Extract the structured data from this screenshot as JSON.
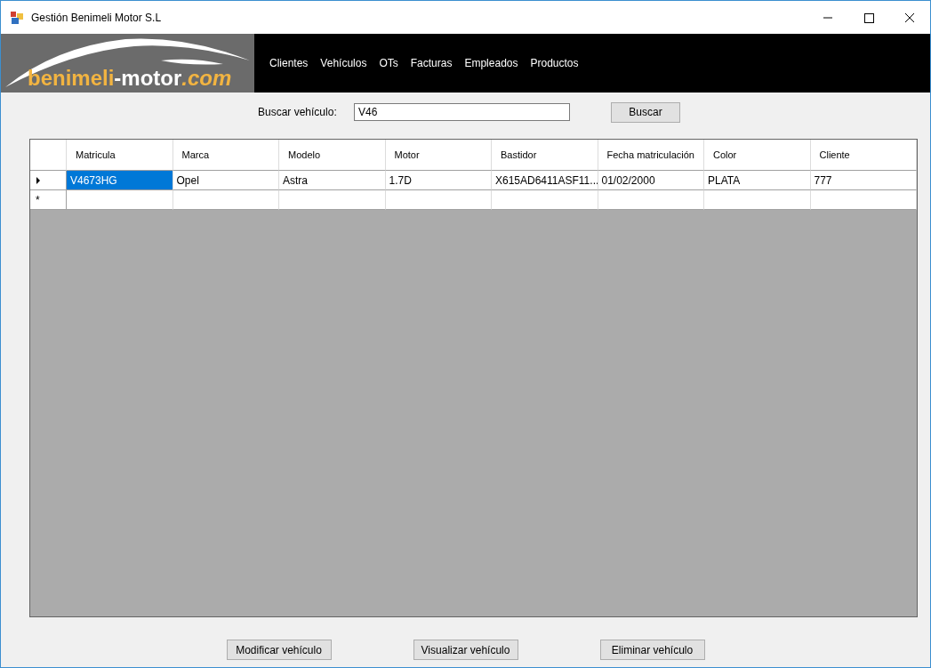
{
  "window": {
    "title": "Gestión Benimeli Motor S.L"
  },
  "logo": [
    "benimeli",
    "-motor",
    ".com"
  ],
  "menu": [
    {
      "label": "Clientes"
    },
    {
      "label": "Vehículos"
    },
    {
      "label": "OTs"
    },
    {
      "label": "Facturas"
    },
    {
      "label": "Empleados"
    },
    {
      "label": "Productos"
    }
  ],
  "search": {
    "label": "Buscar vehículo:",
    "value": "V46",
    "button": "Buscar"
  },
  "table": {
    "columns": [
      "Matricula",
      "Marca",
      "Modelo",
      "Motor",
      "Bastidor",
      "Fecha matriculación",
      "Color",
      "Cliente"
    ],
    "rows": [
      {
        "kind": "data",
        "current": true,
        "cells": [
          {
            "text": "V4673HG",
            "selected": true
          },
          {
            "text": "Opel",
            "selected": false
          },
          {
            "text": "Astra",
            "selected": false
          },
          {
            "text": "1.7D",
            "selected": false
          },
          {
            "text": "X615AD6411ASF11...",
            "selected": false
          },
          {
            "text": "01/02/2000",
            "selected": false
          },
          {
            "text": "PLATA",
            "selected": false
          },
          {
            "text": "777",
            "selected": false
          }
        ]
      },
      {
        "kind": "new",
        "current": false,
        "marker": "*"
      }
    ]
  },
  "buttons": [
    "Modificar vehículo",
    "Visualizar vehículo",
    "Eliminar vehículo"
  ]
}
